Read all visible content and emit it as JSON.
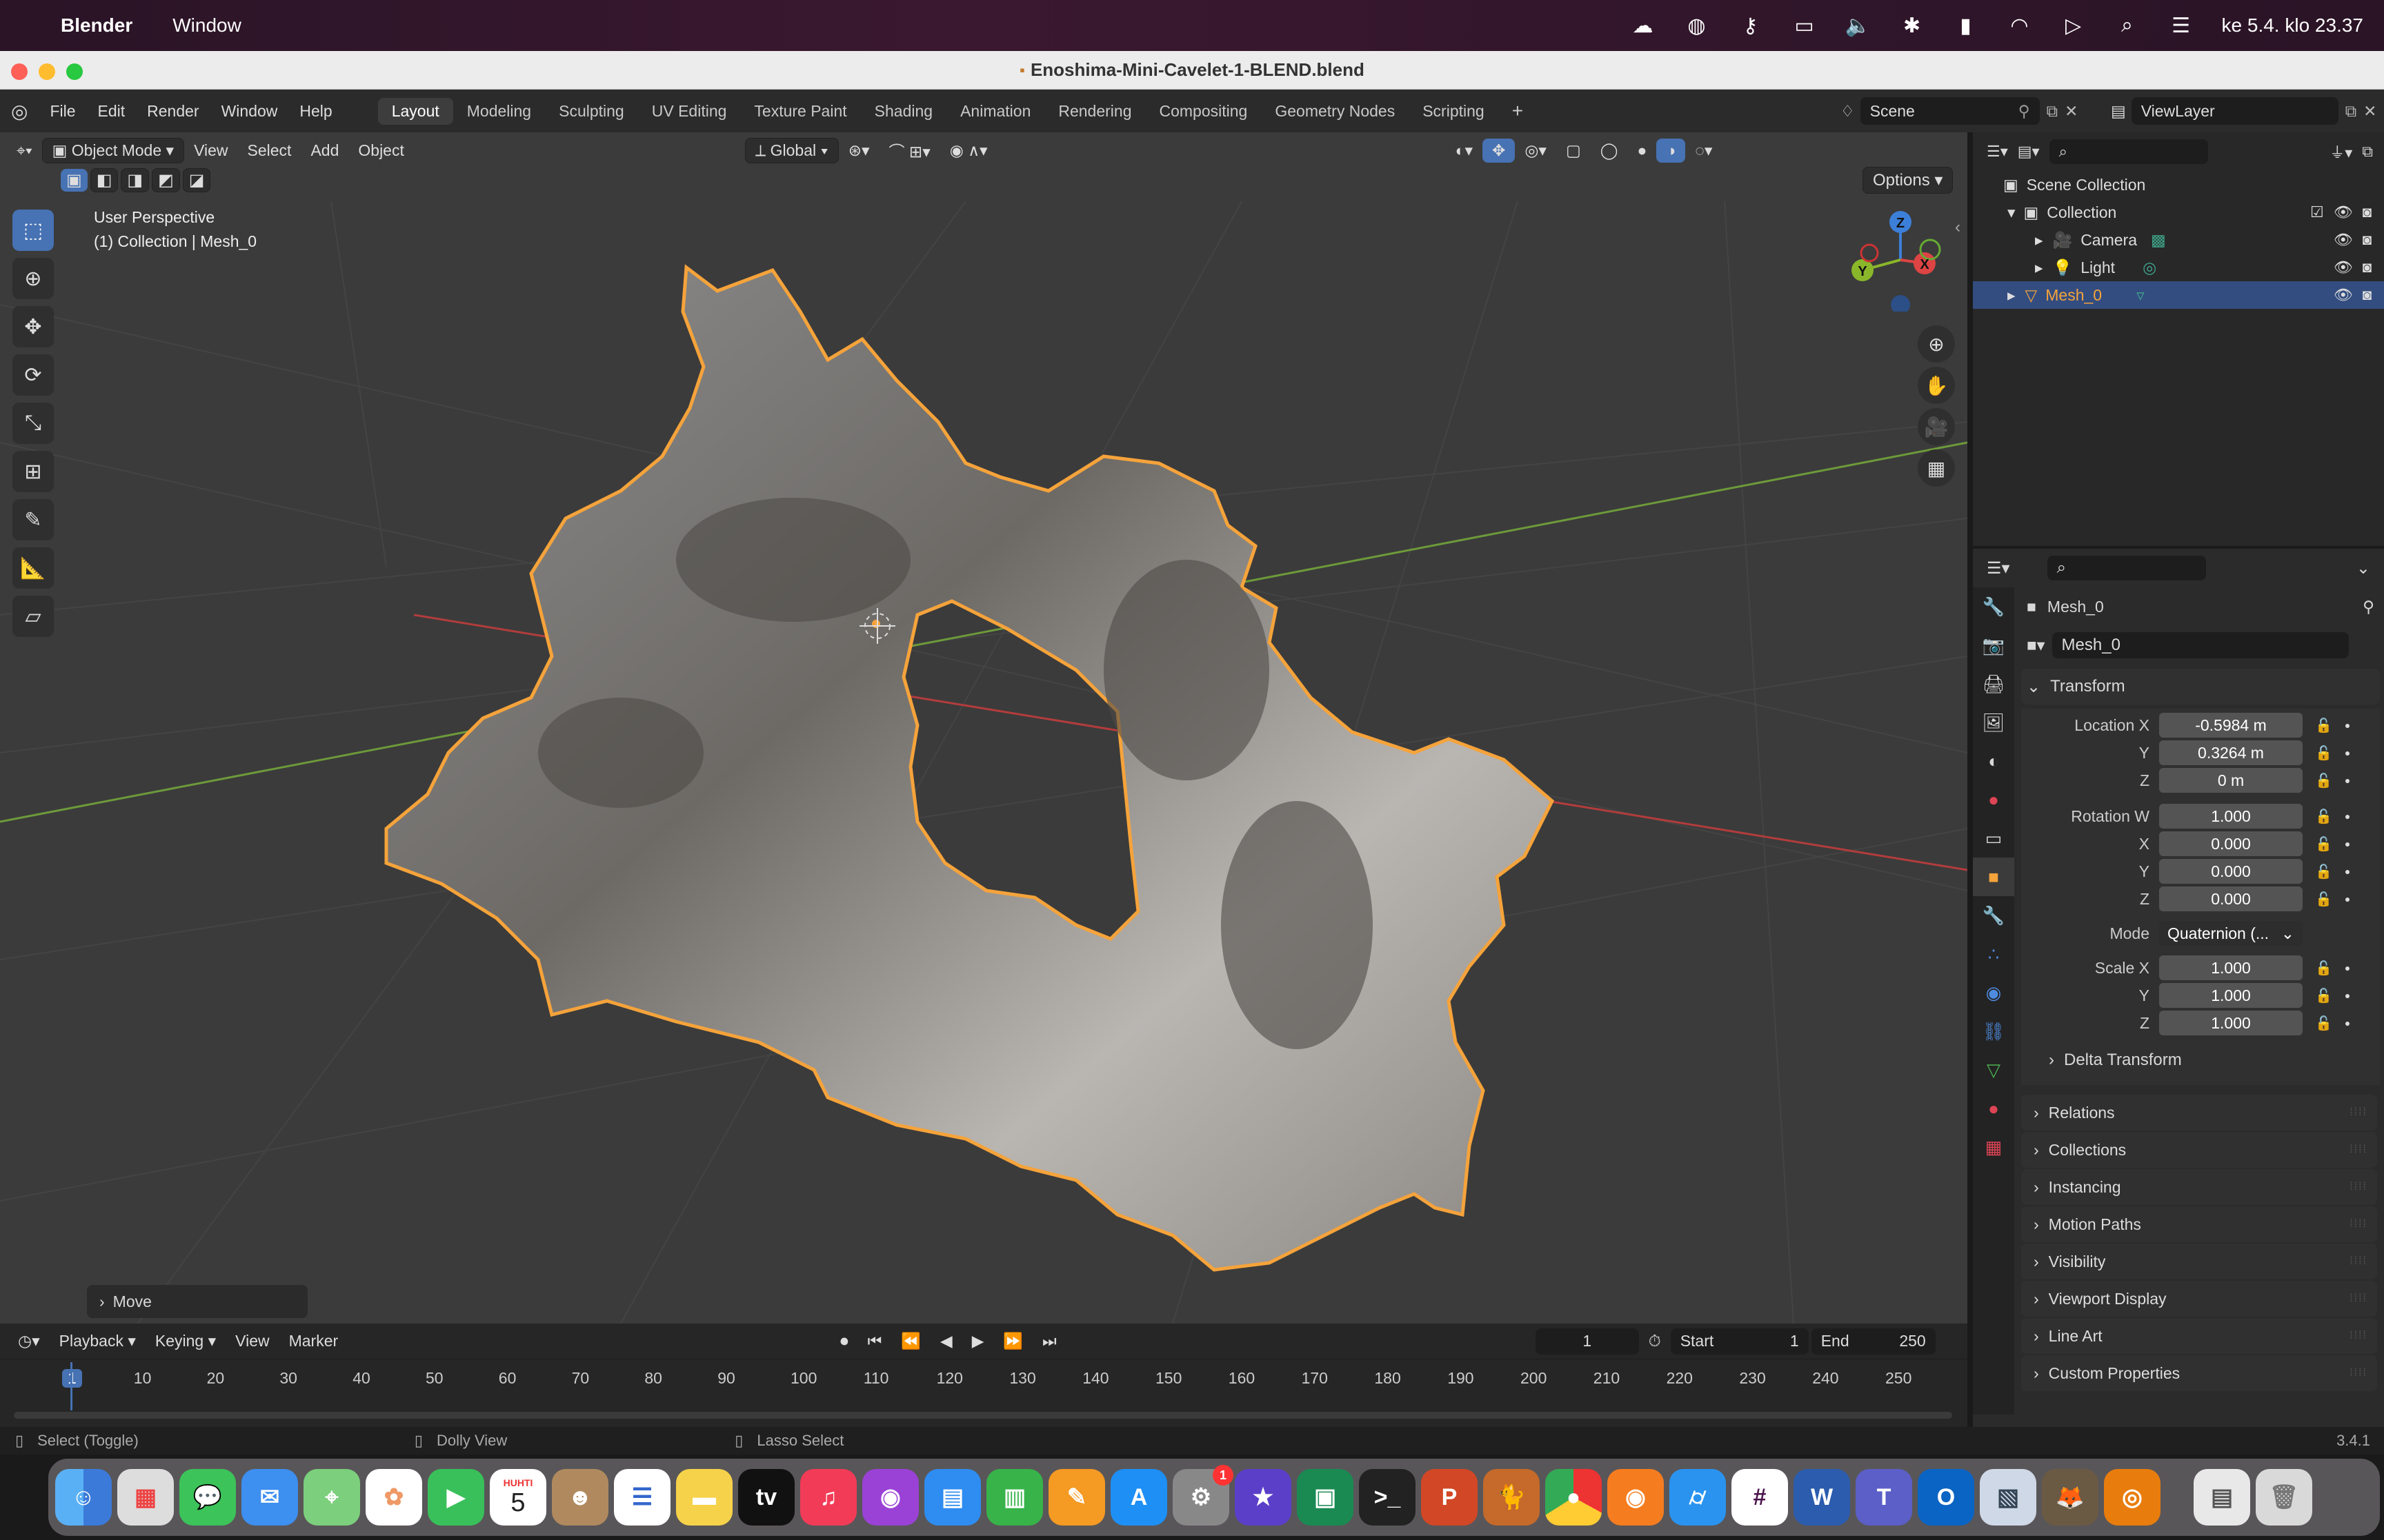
{
  "menubar": {
    "app": "Blender",
    "window": "Window",
    "datetime": "ke 5.4. klo 23.37"
  },
  "window": {
    "title": "Enoshima-Mini-Cavelet-1-BLEND.blend"
  },
  "topbar": {
    "menus": [
      "File",
      "Edit",
      "Render",
      "Window",
      "Help"
    ],
    "workspaces": [
      "Layout",
      "Modeling",
      "Sculpting",
      "UV Editing",
      "Texture Paint",
      "Shading",
      "Animation",
      "Rendering",
      "Compositing",
      "Geometry Nodes",
      "Scripting"
    ],
    "active_workspace": "Layout",
    "scene": "Scene",
    "view_layer": "ViewLayer"
  },
  "viewport": {
    "mode": "Object Mode",
    "menus": [
      "View",
      "Select",
      "Add",
      "Object"
    ],
    "orientation": "Global",
    "options": "Options",
    "overlay_line1": "User Perspective",
    "overlay_line2": "(1) Collection | Mesh_0",
    "last_op": "Move",
    "gizmo": {
      "z": "Z",
      "y": "Y",
      "x": "X"
    }
  },
  "outliner": {
    "root": "Scene Collection",
    "collection": "Collection",
    "items": [
      "Camera",
      "Light",
      "Mesh_0"
    ],
    "selected": "Mesh_0"
  },
  "properties": {
    "object_name": "Mesh_0",
    "datablock": "Mesh_0",
    "transform_title": "Transform",
    "location": {
      "label": "Location X",
      "x": "-0.5984 m",
      "y": "0.3264 m",
      "z": "0 m"
    },
    "rotation": {
      "label": "Rotation W",
      "w": "1.000",
      "x": "0.000",
      "y": "0.000",
      "z": "0.000"
    },
    "mode_label": "Mode",
    "mode_value": "Quaternion (...",
    "scale": {
      "label": "Scale X",
      "x": "1.000",
      "y": "1.000",
      "z": "1.000"
    },
    "axis_labels": {
      "y": "Y",
      "z": "Z",
      "x": "X"
    },
    "panels": [
      "Delta Transform",
      "Relations",
      "Collections",
      "Instancing",
      "Motion Paths",
      "Visibility",
      "Viewport Display",
      "Line Art",
      "Custom Properties"
    ]
  },
  "timeline": {
    "menus": [
      "Playback",
      "Keying",
      "View",
      "Marker"
    ],
    "current_frame": "1",
    "start_label": "Start",
    "start": "1",
    "end_label": "End",
    "end": "250",
    "ticks": [
      "1",
      "10",
      "20",
      "30",
      "40",
      "50",
      "60",
      "70",
      "80",
      "90",
      "100",
      "110",
      "120",
      "130",
      "140",
      "150",
      "160",
      "170",
      "180",
      "190",
      "200",
      "210",
      "220",
      "230",
      "240",
      "250"
    ]
  },
  "statusbar": {
    "left": "Select (Toggle)",
    "mid": "Dolly View",
    "right": "Lasso Select",
    "version": "3.4.1"
  },
  "dock": {
    "calendar_month": "HUHTI",
    "calendar_day": "5",
    "badge": "1",
    "apps": [
      "Finder",
      "Launchpad",
      "Messages",
      "Mail",
      "Maps",
      "Photos",
      "FaceTime",
      "Calendar",
      "Contacts",
      "Reminders",
      "Notes",
      "TV",
      "Music",
      "Podcasts",
      "Keynote",
      "Numbers",
      "Pages",
      "App Store",
      "System Settings",
      "iMovie",
      "Screen",
      "Terminal",
      "PowerPoint",
      "Cat",
      "Chrome",
      "Firefox",
      "Safari",
      "Slack",
      "Word",
      "Teams",
      "Outlook",
      "Preview",
      "GIMP",
      "Blender",
      "Finder Docs",
      "Trash"
    ]
  },
  "colors": {
    "accent": "#4772b3",
    "selection_outline": "#f5a33b",
    "viewport_bg": "#3b3b3b",
    "grid_red": "#b33c3c",
    "grid_green": "#6d9a3a"
  }
}
